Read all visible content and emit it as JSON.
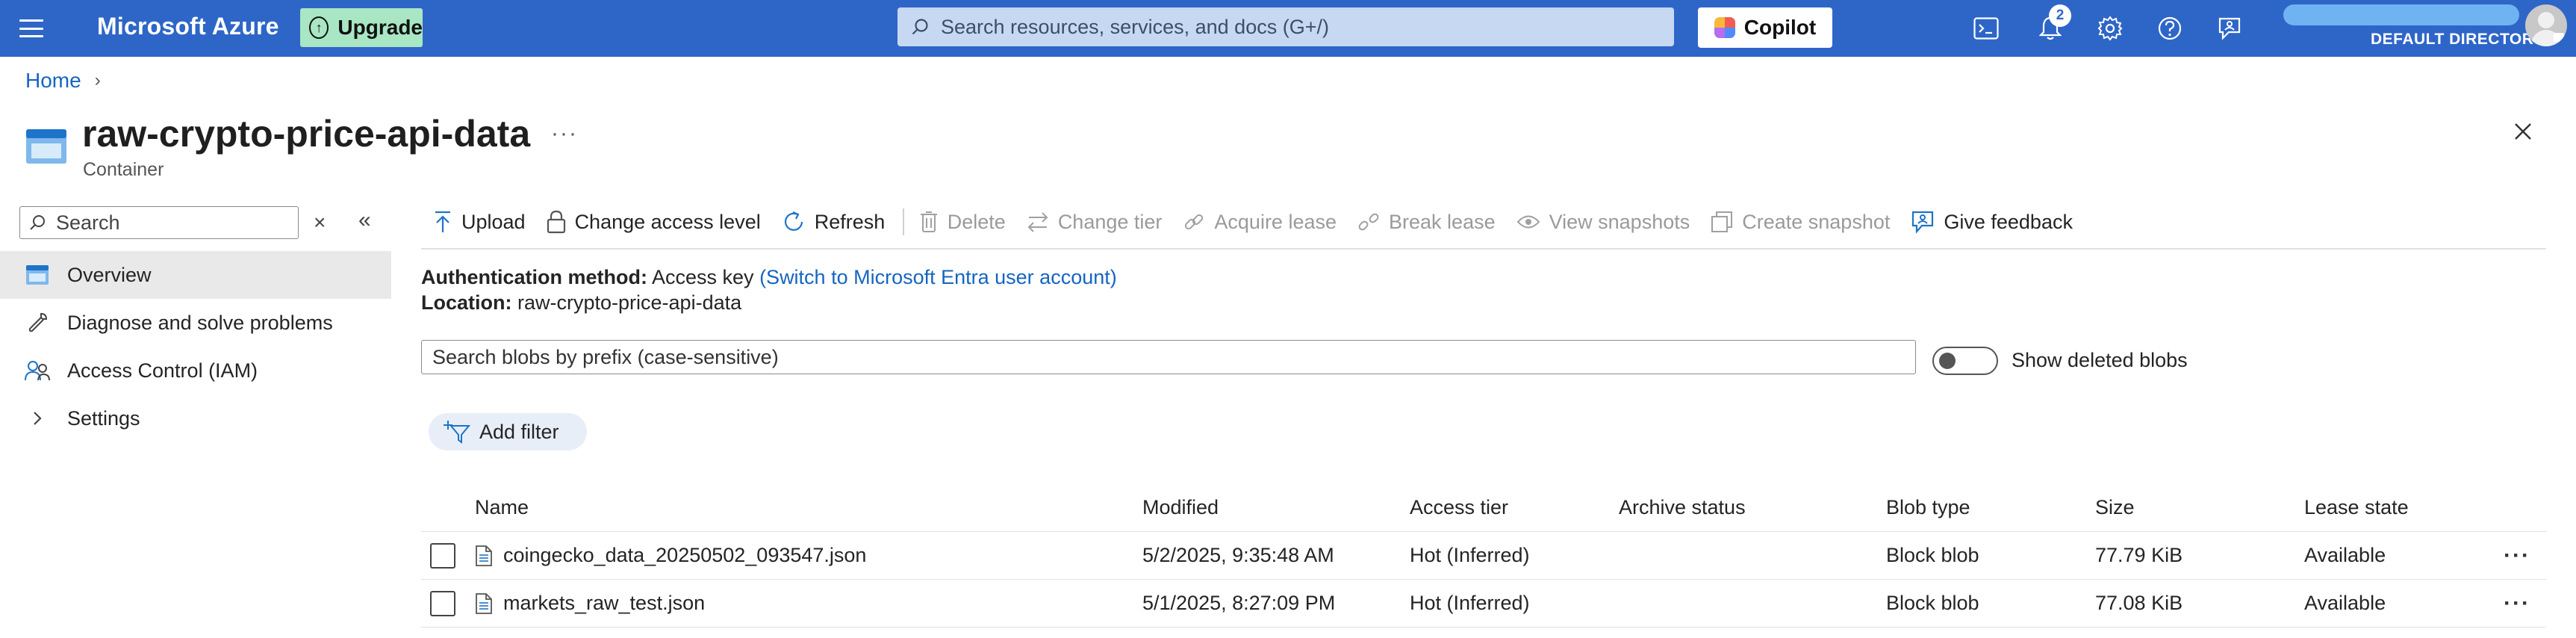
{
  "topbar": {
    "brand": "Microsoft Azure",
    "upgrade_label": "Upgrade",
    "search_placeholder": "Search resources, services, and docs (G+/)",
    "copilot_label": "Copilot",
    "notification_count": "2",
    "directory_label": "DEFAULT DIRECTORY"
  },
  "breadcrumb": {
    "home": "Home"
  },
  "header": {
    "title": "raw-crypto-price-api-data",
    "subtitle": "Container",
    "more_label": "···"
  },
  "nav": {
    "search_placeholder": "Search",
    "items": [
      {
        "label": "Overview",
        "icon": "container-icon"
      },
      {
        "label": "Diagnose and solve problems",
        "icon": "wrench-icon"
      },
      {
        "label": "Access Control (IAM)",
        "icon": "people-icon"
      },
      {
        "label": "Settings",
        "icon": "chevron-right-icon"
      }
    ]
  },
  "toolbar": {
    "upload": "Upload",
    "change_access_level": "Change access level",
    "refresh": "Refresh",
    "delete": "Delete",
    "change_tier": "Change tier",
    "acquire_lease": "Acquire lease",
    "break_lease": "Break lease",
    "view_snapshots": "View snapshots",
    "create_snapshot": "Create snapshot",
    "give_feedback": "Give feedback"
  },
  "info": {
    "auth_label": "Authentication method:",
    "auth_value": "Access key",
    "auth_link": "(Switch to Microsoft Entra user account)",
    "location_label": "Location:",
    "location_value": "raw-crypto-price-api-data"
  },
  "blob_search": {
    "placeholder": "Search blobs by prefix (case-sensitive)"
  },
  "show_deleted": {
    "label": "Show deleted blobs",
    "enabled": false
  },
  "filter": {
    "label": "Add filter"
  },
  "table": {
    "columns": [
      "Name",
      "Modified",
      "Access tier",
      "Archive status",
      "Blob type",
      "Size",
      "Lease state"
    ],
    "rows": [
      {
        "name": "coingecko_data_20250502_093547.json",
        "modified": "5/2/2025, 9:35:48 AM",
        "access_tier": "Hot (Inferred)",
        "archive_status": "",
        "blob_type": "Block blob",
        "size": "77.79 KiB",
        "lease_state": "Available"
      },
      {
        "name": "markets_raw_test.json",
        "modified": "5/1/2025, 8:27:09 PM",
        "access_tier": "Hot (Inferred)",
        "archive_status": "",
        "blob_type": "Block blob",
        "size": "77.08 KiB",
        "lease_state": "Available"
      }
    ],
    "row_more_label": "···"
  },
  "colors": {
    "topbar": "#2e66c8",
    "link": "#1565c0",
    "upgrade": "#a8e6c4"
  }
}
